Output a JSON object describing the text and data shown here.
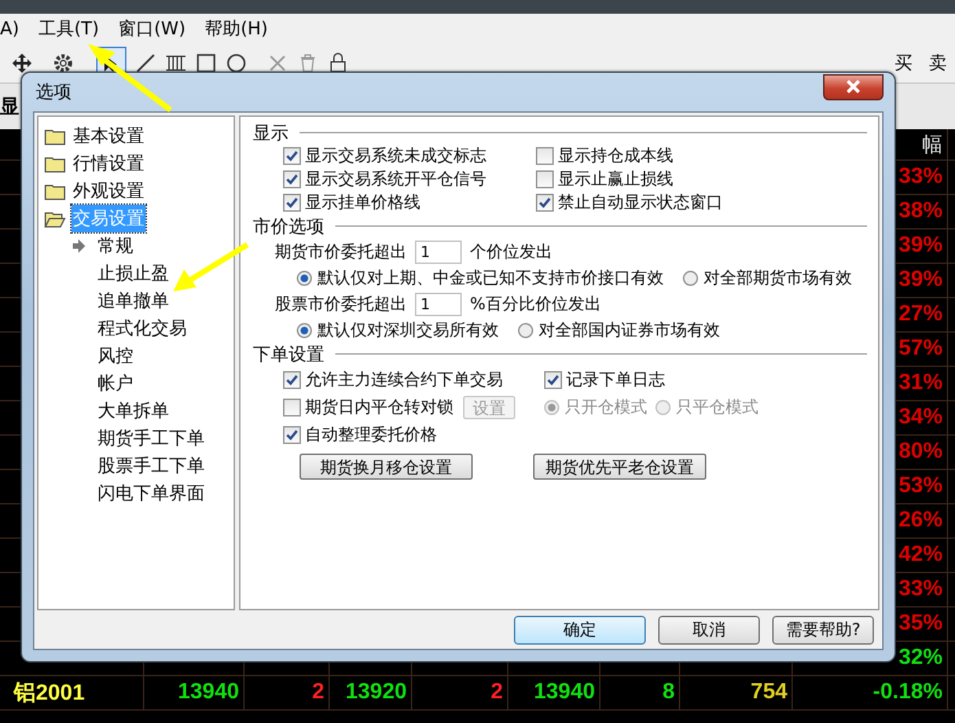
{
  "menu_bar": {
    "items": [
      "A)",
      "工具(T)",
      "窗口(W)",
      "帮助(H)"
    ]
  },
  "toolbar": {
    "labels": [
      "买",
      "卖"
    ]
  },
  "side_caption": "显",
  "market_table": {
    "header": "幅",
    "percent_column": [
      {
        "value": "33%",
        "color": "#e00000"
      },
      {
        "value": "38%",
        "color": "#e00000"
      },
      {
        "value": "39%",
        "color": "#e00000"
      },
      {
        "value": "39%",
        "color": "#e00000"
      },
      {
        "value": "27%",
        "color": "#e00000"
      },
      {
        "value": "57%",
        "color": "#e00000"
      },
      {
        "value": "31%",
        "color": "#e00000"
      },
      {
        "value": "34%",
        "color": "#e00000"
      },
      {
        "value": "80%",
        "color": "#e00000"
      },
      {
        "value": "53%",
        "color": "#e00000"
      },
      {
        "value": "26%",
        "color": "#e00000"
      },
      {
        "value": "42%",
        "color": "#e00000"
      },
      {
        "value": "33%",
        "color": "#e00000"
      },
      {
        "value": "35%",
        "color": "#e00000"
      },
      {
        "value": "32%",
        "color": "#10e010"
      }
    ],
    "last_row": [
      {
        "value": "铝2001",
        "color": "#ffff40"
      },
      {
        "value": "13940",
        "color": "#10e010"
      },
      {
        "value": "2",
        "color": "#ff2020"
      },
      {
        "value": "13920",
        "color": "#10e010"
      },
      {
        "value": "2",
        "color": "#ff2020"
      },
      {
        "value": "13940",
        "color": "#10e010"
      },
      {
        "value": "8",
        "color": "#10e010"
      },
      {
        "value": "754",
        "color": "#e0d020"
      },
      {
        "value": "-0.18%",
        "color": "#10e010"
      }
    ]
  },
  "dialog": {
    "title": "选项",
    "tree": [
      {
        "label": "基本设置",
        "selected": false,
        "expanded": false
      },
      {
        "label": "行情设置",
        "selected": false,
        "expanded": false
      },
      {
        "label": "外观设置",
        "selected": false,
        "expanded": false
      },
      {
        "label": "交易设置",
        "selected": true,
        "expanded": true,
        "children": [
          {
            "label": "常规",
            "selected": true
          },
          {
            "label": "止损止盈",
            "selected": false
          },
          {
            "label": "追单撤单",
            "selected": false
          },
          {
            "label": "程式化交易",
            "selected": false
          },
          {
            "label": "风控",
            "selected": false
          },
          {
            "label": "帐户",
            "selected": false
          },
          {
            "label": "大单拆单",
            "selected": false
          },
          {
            "label": "期货手工下单",
            "selected": false
          },
          {
            "label": "股票手工下单",
            "selected": false
          },
          {
            "label": "闪电下单界面",
            "selected": false
          }
        ]
      }
    ],
    "display": {
      "title": "显示",
      "checkboxes": [
        {
          "label": "显示交易系统未成交标志",
          "checked": true
        },
        {
          "label": "显示交易系统开平仓信号",
          "checked": true
        },
        {
          "label": "显示挂单价格线",
          "checked": true
        },
        {
          "label": "显示持仓成本线",
          "checked": false
        },
        {
          "label": "显示止赢止损线",
          "checked": false
        },
        {
          "label": "禁止自动显示状态窗口",
          "checked": true
        }
      ]
    },
    "market_price": {
      "title": "市价选项",
      "groups": [
        {
          "label": "期货市价委托超出",
          "value": "1",
          "suffix": "个价位发出",
          "radios": [
            {
              "label": "默认仅对上期、中金或已知不支持市价接口有效",
              "selected": true
            },
            {
              "label": "对全部期货市场有效",
              "selected": false
            }
          ]
        },
        {
          "label": "股票市价委托超出",
          "value": "1",
          "suffix": "%百分比价位发出",
          "radios": [
            {
              "label": "默认仅对深圳交易所有效",
              "selected": true
            },
            {
              "label": "对全部国内证券市场有效",
              "selected": false
            }
          ]
        }
      ]
    },
    "order": {
      "title": "下单设置",
      "continuous": {
        "label": "允许主力连续合约下单交易",
        "checked": true
      },
      "log": {
        "label": "记录下单日志",
        "checked": true
      },
      "lock": {
        "label": "期货日内平仓转对锁",
        "checked": false
      },
      "lock_button": {
        "label": "设置",
        "disabled": true
      },
      "modes": [
        {
          "label": "只开仓模式",
          "selected": true,
          "disabled": true
        },
        {
          "label": "只平仓模式",
          "selected": false,
          "disabled": true
        }
      ],
      "auto_price": {
        "label": "自动整理委托价格",
        "checked": true
      },
      "buttons": [
        "期货换月移仓设置",
        "期货优先平老仓设置"
      ]
    },
    "buttons": [
      {
        "label": "确定",
        "kind": "default"
      },
      {
        "label": "取消",
        "kind": "normal"
      },
      {
        "label": "需要帮助?",
        "kind": "normal"
      }
    ]
  }
}
